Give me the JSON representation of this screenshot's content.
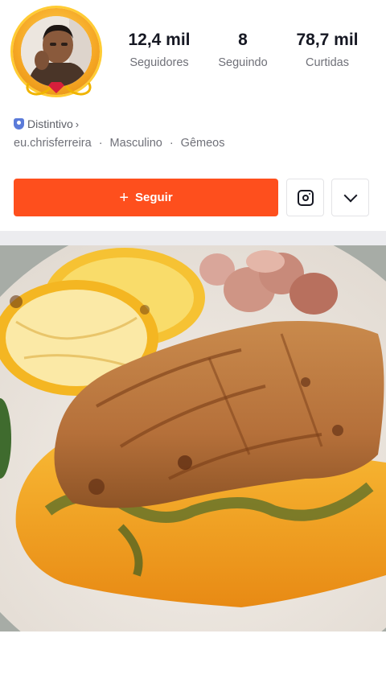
{
  "profile": {
    "stats": [
      {
        "value": "12,4 mil",
        "label": "Seguidores"
      },
      {
        "value": "8",
        "label": "Seguindo"
      },
      {
        "value": "78,7 mil",
        "label": "Curtidas"
      }
    ],
    "badge_label": "Distintivo",
    "username": "eu.chrisferreira",
    "gender": "Masculino",
    "sign": "Gêmeos",
    "separator": "·"
  },
  "actions": {
    "follow_label": "Seguir",
    "follow_color": "#fe4f1d"
  },
  "icons": [
    "shield-icon",
    "plus-icon",
    "instagram-icon",
    "chevron-down-icon"
  ]
}
